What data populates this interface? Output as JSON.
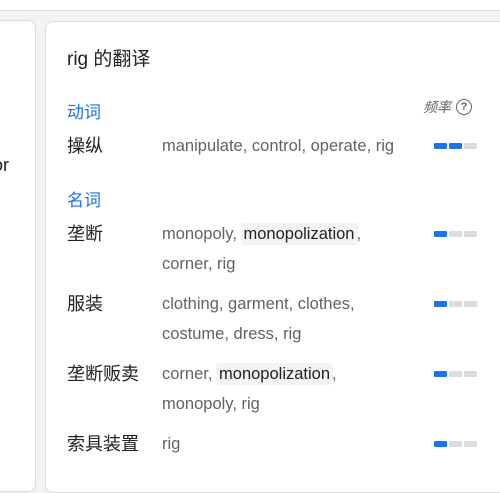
{
  "left_fragment": "or",
  "title": "rig 的翻译",
  "frequency_label": "频率",
  "help_icon": "?",
  "colors": {
    "accent": "#1a73e8",
    "bar_off": "#dadce0"
  },
  "sections": [
    {
      "label": "动词",
      "rows": [
        {
          "term": "操纵",
          "words": [
            "manipulate",
            "control",
            "operate",
            "rig"
          ],
          "highlighted": [],
          "frequency": 2
        }
      ]
    },
    {
      "label": "名词",
      "rows": [
        {
          "term": "垄断",
          "words": [
            "monopoly",
            "monopolization",
            "corner",
            "rig"
          ],
          "highlighted": [
            "monopolization"
          ],
          "frequency": 1
        },
        {
          "term": "服装",
          "words": [
            "clothing",
            "garment",
            "clothes",
            "costume",
            "dress",
            "rig"
          ],
          "highlighted": [],
          "frequency": 1
        },
        {
          "term": "垄断贩卖",
          "words": [
            "corner",
            "monopolization",
            "monopoly",
            "rig"
          ],
          "highlighted": [
            "monopolization"
          ],
          "frequency": 1
        },
        {
          "term": "索具装置",
          "words": [
            "rig"
          ],
          "highlighted": [],
          "frequency": 1
        }
      ]
    }
  ]
}
